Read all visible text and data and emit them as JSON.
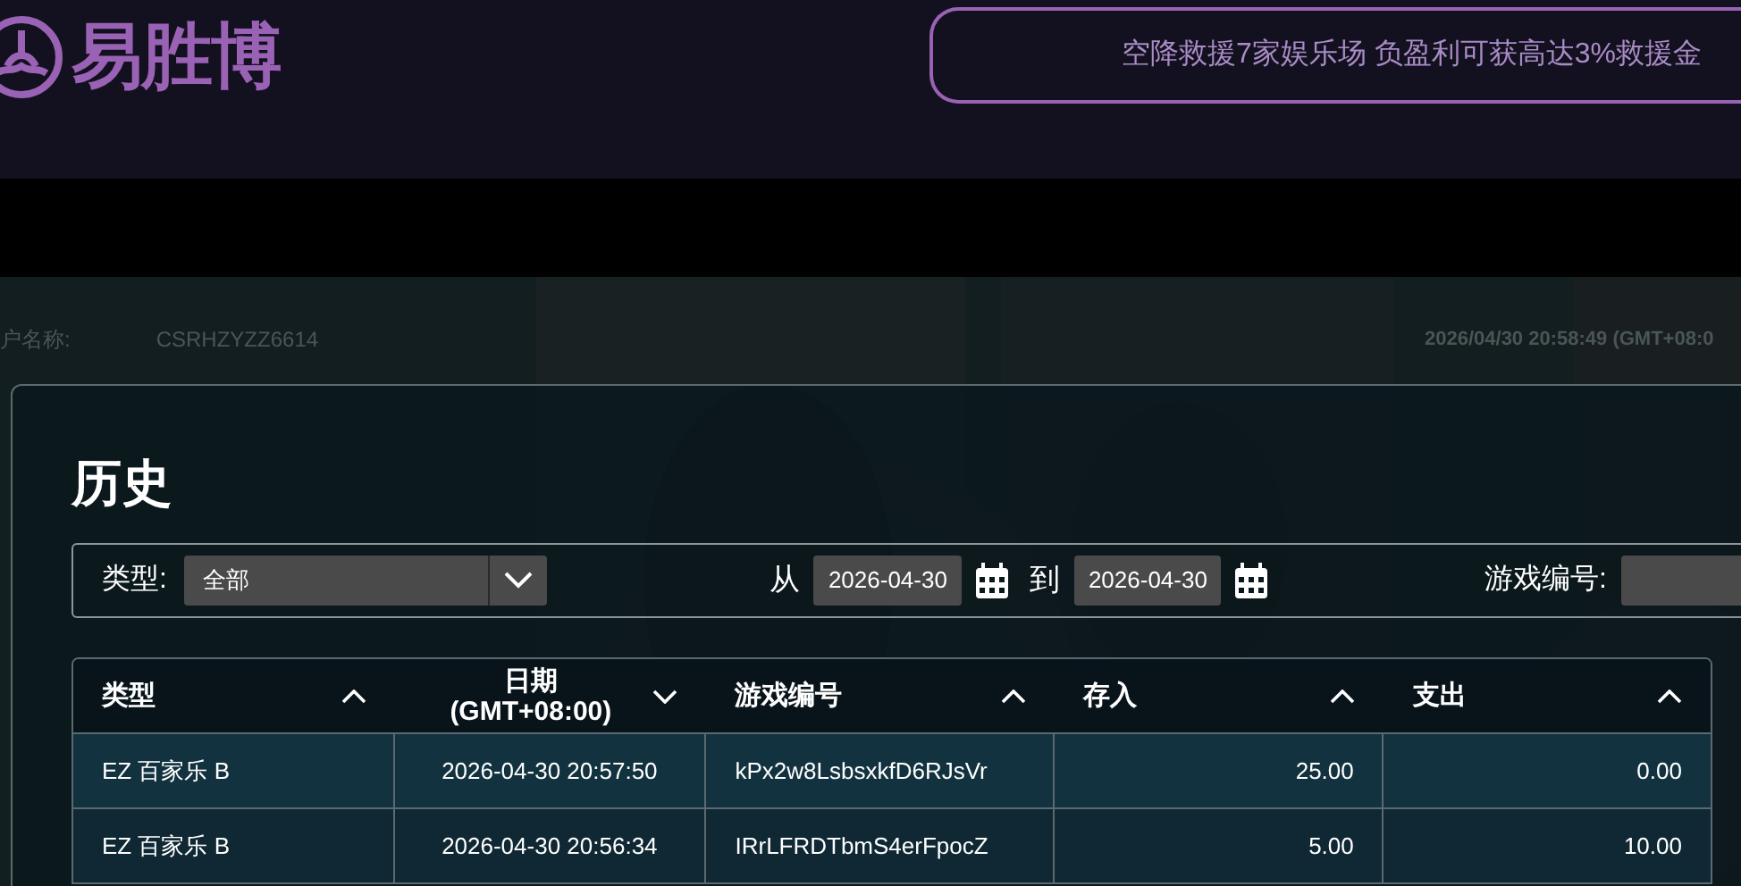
{
  "header": {
    "logo_text": "易胜博",
    "marquee": "空降救援7家娱乐场 负盈利可获高达3%救援金"
  },
  "background_page": {
    "account_label": "户名称:",
    "account_value": "CSRHZYZZ6614",
    "datetime": "2026/04/30  20:58:49  (GMT+08:0"
  },
  "dialog": {
    "title": "历史",
    "filters": {
      "type_label": "类型:",
      "type_value": "全部",
      "from_label": "从",
      "from_date": "2026-04-30",
      "to_label": "到",
      "to_date": "2026-04-30",
      "game_id_label": "游戏编号:"
    },
    "table": {
      "columns": [
        {
          "label": "类型",
          "sorted_descending": false
        },
        {
          "label": "日期\n(GMT+08:00)",
          "sorted_descending": true
        },
        {
          "label": "游戏编号",
          "sorted_descending": false
        },
        {
          "label": "存入",
          "sorted_descending": false
        },
        {
          "label": "支出",
          "sorted_descending": false
        }
      ],
      "rows": [
        [
          "EZ 百家乐 B",
          "2026-04-30 20:57:50",
          "kPx2w8LsbsxkfD6RJsVr",
          "25.00",
          "0.00"
        ],
        [
          "EZ 百家乐 B",
          "2026-04-30 20:56:34",
          "IRrLFRDTbmS4erFpocZ",
          "5.00",
          "10.00"
        ]
      ]
    }
  }
}
